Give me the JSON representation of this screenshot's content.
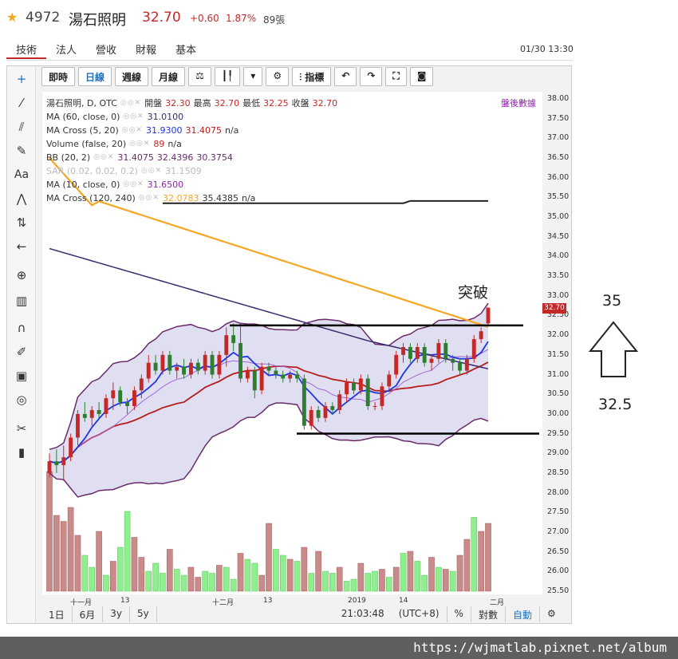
{
  "header": {
    "code": "4972",
    "name": "湯石照明",
    "price": "32.70",
    "change": "+0.60",
    "pct": "1.87%",
    "volume": "89張"
  },
  "tabs": [
    "技術",
    "法人",
    "營收",
    "營收",
    "財報",
    "基本"
  ],
  "nav_tabs": [
    "技術",
    "法人",
    "營收",
    "財報",
    "基本"
  ],
  "datetime": "01/30 13:30",
  "toolbar": {
    "b1": "即時",
    "b2": "日線",
    "b3": "週線",
    "b4": "月線",
    "b5": "指標"
  },
  "legend": {
    "main": {
      "label": "湯石照明, D, OTC",
      "open_l": "開盤",
      "open": "32.30",
      "high_l": "最高",
      "high": "32.70",
      "low_l": "最低",
      "low": "32.25",
      "close_l": "收盤",
      "close": "32.70"
    },
    "ma60": {
      "label": "MA (60, close, 0)",
      "v": "31.0100"
    },
    "macross5": {
      "label": "MA Cross (5, 20)",
      "v1": "31.9300",
      "v2": "31.4075",
      "v3": "n/a"
    },
    "volume": {
      "label": "Volume (false, 20)",
      "v1": "89",
      "v2": "n/a"
    },
    "bb": {
      "label": "BB (20, 2)",
      "v1": "31.4075",
      "v2": "32.4396",
      "v3": "30.3754"
    },
    "sar": {
      "label": "SAR (0.02, 0.02, 0.2)",
      "v": "31.1509"
    },
    "ma10": {
      "label": "MA (10, close, 0)",
      "v": "31.6500"
    },
    "macross120": {
      "label": "MA Cross (120, 240)",
      "v1": "32.0783",
      "v2": "35.4385",
      "v3": "n/a"
    }
  },
  "after_hours": "盤後數據",
  "price_tag": "32.70",
  "bottom": {
    "d1": "1日",
    "m6": "6月",
    "y3": "3y",
    "y5": "5y",
    "time": "21:03:48",
    "tz": "(UTC+8)",
    "pct": "%",
    "log": "對數",
    "auto": "自動"
  },
  "annotations": {
    "breakout": "突破",
    "target": "35",
    "base": "32.5"
  },
  "watermark": "https://wjmatlab.pixnet.net/album",
  "colors": {
    "up": "#c62828",
    "down": "#2e7d32",
    "ma5": "#1e35e0",
    "ma20": "#b71c1c",
    "ma120": "#f5a623",
    "ma240": "#222",
    "ma60": "#3c2a6e",
    "bb": "#6a2a6a"
  },
  "chart_data": {
    "type": "candlestick",
    "ylim": [
      25.5,
      38.0
    ],
    "y_ticks": [
      "38.00",
      "37.50",
      "37.00",
      "36.50",
      "36.00",
      "35.50",
      "35.00",
      "34.50",
      "34.00",
      "33.50",
      "33.00",
      "32.50",
      "32.00",
      "31.50",
      "31.00",
      "30.50",
      "30.00",
      "29.50",
      "29.00",
      "28.50",
      "28.00",
      "27.50",
      "27.00",
      "26.50",
      "26.00",
      "25.50"
    ],
    "x_labels": [
      "十一月",
      "13",
      "十二月",
      "13",
      "2019",
      "14",
      "二月"
    ],
    "candles": [
      {
        "o": 28.5,
        "h": 29.0,
        "l": 28.4,
        "c": 28.8
      },
      {
        "o": 28.8,
        "h": 29.1,
        "l": 28.5,
        "c": 28.7
      },
      {
        "o": 28.7,
        "h": 29.2,
        "l": 28.3,
        "c": 28.9
      },
      {
        "o": 28.9,
        "h": 29.5,
        "l": 28.8,
        "c": 29.4
      },
      {
        "o": 29.4,
        "h": 30.1,
        "l": 29.2,
        "c": 30.0
      },
      {
        "o": 30.0,
        "h": 30.3,
        "l": 29.8,
        "c": 29.9
      },
      {
        "o": 29.9,
        "h": 30.2,
        "l": 29.7,
        "c": 30.1
      },
      {
        "o": 30.1,
        "h": 30.3,
        "l": 29.9,
        "c": 30.0
      },
      {
        "o": 30.0,
        "h": 30.5,
        "l": 29.9,
        "c": 30.4
      },
      {
        "o": 30.4,
        "h": 30.8,
        "l": 30.1,
        "c": 30.6
      },
      {
        "o": 30.6,
        "h": 30.7,
        "l": 30.2,
        "c": 30.3
      },
      {
        "o": 30.3,
        "h": 30.4,
        "l": 30.0,
        "c": 30.2
      },
      {
        "o": 30.2,
        "h": 30.7,
        "l": 30.1,
        "c": 30.6
      },
      {
        "o": 30.6,
        "h": 31.0,
        "l": 30.4,
        "c": 30.9
      },
      {
        "o": 30.9,
        "h": 31.5,
        "l": 30.8,
        "c": 31.3
      },
      {
        "o": 31.3,
        "h": 31.5,
        "l": 31.0,
        "c": 31.1
      },
      {
        "o": 31.1,
        "h": 31.6,
        "l": 31.0,
        "c": 31.5
      },
      {
        "o": 31.5,
        "h": 31.6,
        "l": 31.0,
        "c": 31.1
      },
      {
        "o": 31.1,
        "h": 31.3,
        "l": 30.9,
        "c": 31.2
      },
      {
        "o": 31.2,
        "h": 31.4,
        "l": 30.9,
        "c": 31.0
      },
      {
        "o": 31.0,
        "h": 31.4,
        "l": 30.9,
        "c": 31.3
      },
      {
        "o": 31.3,
        "h": 31.4,
        "l": 31.0,
        "c": 31.1
      },
      {
        "o": 31.1,
        "h": 31.6,
        "l": 31.0,
        "c": 31.5
      },
      {
        "o": 31.5,
        "h": 31.6,
        "l": 30.9,
        "c": 31.0
      },
      {
        "o": 31.0,
        "h": 31.6,
        "l": 30.9,
        "c": 31.5
      },
      {
        "o": 31.5,
        "h": 32.2,
        "l": 31.2,
        "c": 32.0
      },
      {
        "o": 32.0,
        "h": 32.3,
        "l": 31.6,
        "c": 31.8
      },
      {
        "o": 31.8,
        "h": 32.3,
        "l": 30.8,
        "c": 30.9
      },
      {
        "o": 30.9,
        "h": 31.2,
        "l": 30.8,
        "c": 31.1
      },
      {
        "o": 31.1,
        "h": 31.2,
        "l": 30.4,
        "c": 30.6
      },
      {
        "o": 30.6,
        "h": 31.3,
        "l": 30.5,
        "c": 31.2
      },
      {
        "o": 31.2,
        "h": 31.3,
        "l": 31.0,
        "c": 31.1
      },
      {
        "o": 31.1,
        "h": 31.2,
        "l": 30.9,
        "c": 31.0
      },
      {
        "o": 31.0,
        "h": 31.1,
        "l": 30.8,
        "c": 30.9
      },
      {
        "o": 30.9,
        "h": 31.1,
        "l": 30.8,
        "c": 31.0
      },
      {
        "o": 31.0,
        "h": 31.1,
        "l": 30.8,
        "c": 30.9
      },
      {
        "o": 30.9,
        "h": 31.0,
        "l": 29.6,
        "c": 29.7
      },
      {
        "o": 29.7,
        "h": 30.2,
        "l": 29.6,
        "c": 30.1
      },
      {
        "o": 30.1,
        "h": 30.2,
        "l": 29.8,
        "c": 29.9
      },
      {
        "o": 29.9,
        "h": 30.3,
        "l": 29.8,
        "c": 30.2
      },
      {
        "o": 30.2,
        "h": 30.3,
        "l": 30.0,
        "c": 30.1
      },
      {
        "o": 30.1,
        "h": 30.6,
        "l": 30.0,
        "c": 30.5
      },
      {
        "o": 30.5,
        "h": 30.9,
        "l": 30.3,
        "c": 30.8
      },
      {
        "o": 30.8,
        "h": 30.9,
        "l": 30.5,
        "c": 30.6
      },
      {
        "o": 30.6,
        "h": 31.0,
        "l": 30.5,
        "c": 30.9
      },
      {
        "o": 30.9,
        "h": 31.0,
        "l": 30.1,
        "c": 30.2
      },
      {
        "o": 30.2,
        "h": 30.3,
        "l": 30.1,
        "c": 30.2
      },
      {
        "o": 30.2,
        "h": 30.8,
        "l": 30.1,
        "c": 30.7
      },
      {
        "o": 30.7,
        "h": 31.1,
        "l": 30.6,
        "c": 31.0
      },
      {
        "o": 31.0,
        "h": 31.6,
        "l": 30.9,
        "c": 31.5
      },
      {
        "o": 31.5,
        "h": 31.8,
        "l": 31.3,
        "c": 31.7
      },
      {
        "o": 31.7,
        "h": 31.8,
        "l": 31.3,
        "c": 31.4
      },
      {
        "o": 31.4,
        "h": 31.8,
        "l": 31.3,
        "c": 31.7
      },
      {
        "o": 31.7,
        "h": 31.8,
        "l": 31.2,
        "c": 31.3
      },
      {
        "o": 31.3,
        "h": 31.5,
        "l": 31.1,
        "c": 31.4
      },
      {
        "o": 31.4,
        "h": 31.9,
        "l": 31.3,
        "c": 31.8
      },
      {
        "o": 31.8,
        "h": 31.9,
        "l": 31.3,
        "c": 31.4
      },
      {
        "o": 31.4,
        "h": 31.5,
        "l": 31.1,
        "c": 31.3
      },
      {
        "o": 31.3,
        "h": 31.4,
        "l": 31.0,
        "c": 31.1
      },
      {
        "o": 31.1,
        "h": 31.5,
        "l": 31.0,
        "c": 31.4
      },
      {
        "o": 31.4,
        "h": 32.0,
        "l": 31.3,
        "c": 31.9
      },
      {
        "o": 31.9,
        "h": 32.2,
        "l": 31.8,
        "c": 32.1
      },
      {
        "o": 32.3,
        "h": 32.7,
        "l": 32.25,
        "c": 32.7
      }
    ],
    "volumes": [
      60,
      38,
      35,
      42,
      28,
      18,
      12,
      30,
      8,
      15,
      22,
      40,
      27,
      17,
      10,
      14,
      9,
      21,
      11,
      8,
      12,
      7,
      10,
      9,
      13,
      12,
      6,
      19,
      16,
      14,
      8,
      34,
      21,
      18,
      16,
      15,
      22,
      9,
      20,
      10,
      9,
      12,
      5,
      6,
      14,
      9,
      10,
      11,
      7,
      12,
      19,
      20,
      15,
      8,
      17,
      12,
      11,
      10,
      18,
      26,
      37,
      30,
      34
    ],
    "volume_up": [
      false,
      false,
      false,
      false,
      false,
      true,
      true,
      false,
      true,
      false,
      true,
      true,
      false,
      false,
      true,
      true,
      true,
      false,
      true,
      true,
      false,
      false,
      true,
      true,
      false,
      true,
      true,
      false,
      true,
      true,
      false,
      false,
      true,
      true,
      false,
      true,
      false,
      true,
      false,
      true,
      true,
      false,
      true,
      true,
      false,
      true,
      true,
      false,
      true,
      false,
      true,
      false,
      true,
      true,
      false,
      true,
      false,
      true,
      false,
      false,
      true,
      false,
      false
    ]
  }
}
